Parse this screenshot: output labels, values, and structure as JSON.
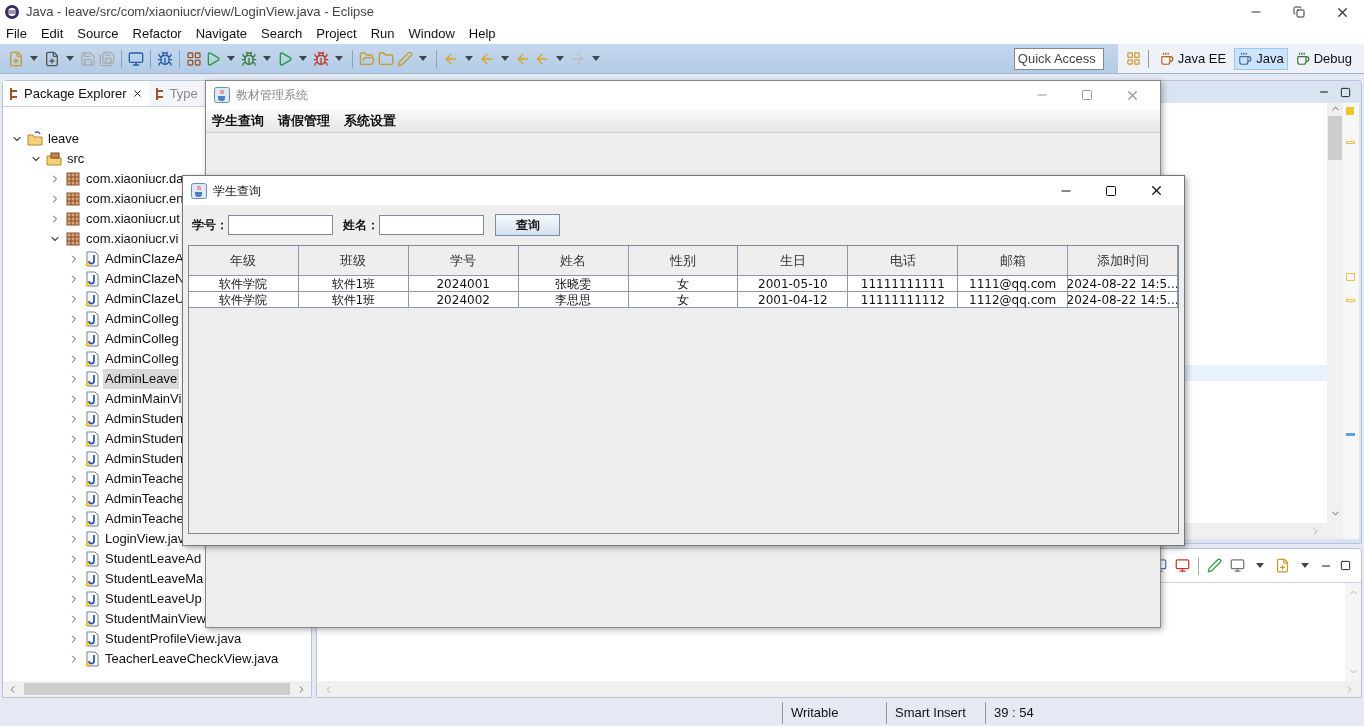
{
  "window": {
    "title": "Java - leave/src/com/xiaoniucr/view/LoginView.java - Eclipse"
  },
  "menu": [
    "File",
    "Edit",
    "Source",
    "Refactor",
    "Navigate",
    "Search",
    "Project",
    "Run",
    "Window",
    "Help"
  ],
  "quick_access": {
    "placeholder": "Quick Access"
  },
  "perspectives": [
    {
      "label": "Java EE",
      "selected": false
    },
    {
      "label": "Java",
      "selected": true
    },
    {
      "label": "Debug",
      "selected": false
    }
  ],
  "package_explorer": {
    "tabs": [
      {
        "label": "Package Explorer",
        "selected": true
      },
      {
        "label": "Type",
        "selected": false
      }
    ],
    "tree": [
      {
        "label": "leave",
        "kind": "project",
        "expanded": true,
        "selected": false,
        "children": [
          {
            "label": "src",
            "kind": "source_folder",
            "expanded": true,
            "selected": false,
            "children": [
              {
                "label": "com.xiaoniucr.da",
                "kind": "package",
                "expanded": false,
                "selected": false
              },
              {
                "label": "com.xiaoniucr.en",
                "kind": "package",
                "expanded": false,
                "selected": false
              },
              {
                "label": "com.xiaoniucr.ut",
                "kind": "package",
                "expanded": false,
                "selected": false
              },
              {
                "label": "com.xiaoniucr.vi",
                "kind": "package",
                "expanded": true,
                "selected": false,
                "children": [
                  {
                    "label": "AdminClazeA",
                    "kind": "java_file",
                    "expanded": false,
                    "selected": false
                  },
                  {
                    "label": "AdminClazeN",
                    "kind": "java_file",
                    "expanded": false,
                    "selected": false
                  },
                  {
                    "label": "AdminClazeU",
                    "kind": "java_file",
                    "expanded": false,
                    "selected": false
                  },
                  {
                    "label": "AdminColleg",
                    "kind": "java_file",
                    "expanded": false,
                    "selected": false
                  },
                  {
                    "label": "AdminColleg",
                    "kind": "java_file",
                    "expanded": false,
                    "selected": false
                  },
                  {
                    "label": "AdminColleg",
                    "kind": "java_file",
                    "expanded": false,
                    "selected": false
                  },
                  {
                    "label": "AdminLeave",
                    "kind": "java_file",
                    "expanded": false,
                    "selected": true
                  },
                  {
                    "label": "AdminMainVi",
                    "kind": "java_file",
                    "expanded": false,
                    "selected": false
                  },
                  {
                    "label": "AdminStuden",
                    "kind": "java_file",
                    "expanded": false,
                    "selected": false
                  },
                  {
                    "label": "AdminStuden",
                    "kind": "java_file",
                    "expanded": false,
                    "selected": false
                  },
                  {
                    "label": "AdminStuden",
                    "kind": "java_file",
                    "expanded": false,
                    "selected": false
                  },
                  {
                    "label": "AdminTeache",
                    "kind": "java_file",
                    "expanded": false,
                    "selected": false
                  },
                  {
                    "label": "AdminTeache",
                    "kind": "java_file",
                    "expanded": false,
                    "selected": false
                  },
                  {
                    "label": "AdminTeache",
                    "kind": "java_file",
                    "expanded": false,
                    "selected": false
                  },
                  {
                    "label": "LoginView.jav",
                    "kind": "java_file",
                    "expanded": false,
                    "selected": false
                  },
                  {
                    "label": "StudentLeaveAd",
                    "kind": "java_file",
                    "expanded": false,
                    "selected": false
                  },
                  {
                    "label": "StudentLeaveMa",
                    "kind": "java_file",
                    "expanded": false,
                    "selected": false
                  },
                  {
                    "label": "StudentLeaveUp",
                    "kind": "java_file",
                    "expanded": false,
                    "selected": false
                  },
                  {
                    "label": "StudentMainView",
                    "kind": "java_file",
                    "expanded": false,
                    "selected": false
                  },
                  {
                    "label": "StudentProfileView.java",
                    "kind": "java_file",
                    "expanded": false,
                    "selected": false
                  },
                  {
                    "label": "TeacherLeaveCheckView.java",
                    "kind": "java_file",
                    "expanded": false,
                    "selected": false
                  }
                ]
              }
            ]
          }
        ]
      }
    ]
  },
  "main_dialog": {
    "title": "教材管理系统",
    "menu": [
      "学生查询",
      "请假管理",
      "系统设置"
    ]
  },
  "query_dialog": {
    "title": "学生查询",
    "fields": [
      {
        "label": "学号："
      },
      {
        "label": "姓名："
      }
    ],
    "button": "查询",
    "table": {
      "columns": [
        "年级",
        "班级",
        "学号",
        "姓名",
        "性别",
        "生日",
        "电话",
        "邮箱",
        "添加时间"
      ],
      "rows": [
        [
          "软件学院",
          "软件1班",
          "2024001",
          "张晓雯",
          "女",
          "2001-05-10",
          "11111111111",
          "1111@qq.com",
          "2024-08-22 14:5..."
        ],
        [
          "软件学院",
          "软件1班",
          "2024002",
          "李思思",
          "女",
          "2001-04-12",
          "11111111112",
          "1112@qq.com",
          "2024-08-22 14:5..."
        ]
      ]
    }
  },
  "status_bar": [
    "Writable",
    "Smart Insert",
    "39 : 54"
  ]
}
